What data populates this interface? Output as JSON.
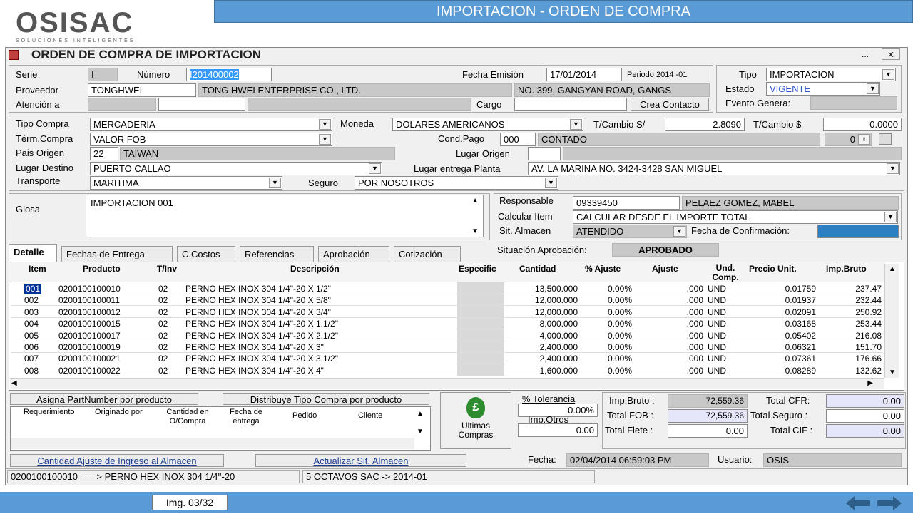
{
  "brand": {
    "logo": "OSISAC",
    "tagline": "SOLUCIONES INTELIGENTES"
  },
  "banner": {
    "title": "IMPORTACION - ORDEN DE COMPRA"
  },
  "window": {
    "title": "ORDEN DE COMPRA DE IMPORTACION",
    "ctrl_more": "...",
    "ctrl_close": "⨯"
  },
  "form": {
    "serie_label": "Serie",
    "serie": "I",
    "numero_label": "Número",
    "numero": "I201400002",
    "fecha_emision_label": "Fecha Emisión",
    "fecha_emision": "17/01/2014",
    "periodo": "Periodo  2014  -01",
    "tipo_label": "Tipo",
    "tipo": "IMPORTACION",
    "estado_label": "Estado",
    "estado": "VIGENTE",
    "evento_label": "Evento Genera:",
    "proveedor_label": "Proveedor",
    "proveedor_code": "TONGHWEI",
    "proveedor_name": "TONG HWEI ENTERPRISE CO., LTD.",
    "proveedor_addr": "NO. 399, GANGYAN ROAD, GANGS",
    "atencion_label": "Atención a",
    "cargo_label": "Cargo",
    "crea_contacto": "Crea Contacto",
    "tipo_compra_label": "Tipo Compra",
    "tipo_compra": "MERCADERIA",
    "moneda_label": "Moneda",
    "moneda": "DOLARES AMERICANOS",
    "tc_s_label": "T/Cambio S/",
    "tc_s": "2.8090",
    "tc_d_label": "T/Cambio $",
    "tc_d": "0.0000",
    "term_label": "Térm.Compra",
    "term": "VALOR FOB",
    "cond_label": "Cond.Pago",
    "cond_code": "000",
    "cond_name": "CONTADO",
    "spin_val": "0",
    "pais_label": "Pais Origen",
    "pais_code": "22",
    "pais_name": "TAIWAN",
    "lugar_origen_label": "Lugar Origen",
    "lugar_destino_label": "Lugar Destino",
    "lugar_destino": "PUERTO CALLAO",
    "lugar_planta_label": "Lugar entrega Planta",
    "lugar_planta": "AV. LA MARINA NO. 3424-3428 SAN MIGUEL",
    "transporte_label": "Transporte",
    "transporte": "MARITIMA",
    "seguro_label": "Seguro",
    "seguro": "POR NOSOTROS",
    "glosa_label": "Glosa",
    "glosa": "IMPORTACION 001",
    "responsable_label": "Responsable",
    "responsable_code": "09339450",
    "responsable_name": "PELAEZ GOMEZ, MABEL",
    "calcular_label": "Calcular Item",
    "calcular": "CALCULAR DESDE EL IMPORTE TOTAL",
    "sit_label": "Sit. Almacen",
    "sit": "ATENDIDO",
    "fecha_conf_label": "Fecha de Confirmación:",
    "sit_aprob_label": "Situación Aprobación:",
    "sit_aprob": "APROBADO"
  },
  "tabs": [
    "Detalle",
    "Fechas de Entrega",
    "C.Costos",
    "Referencias",
    "Aprobación",
    "Cotización"
  ],
  "grid": {
    "headers": [
      "Item",
      "Producto",
      "T/Inv",
      "Descripción",
      "Especific",
      "Cantidad",
      "% Ajuste",
      "Ajuste",
      "Und. Comp.",
      "Precio Unit.",
      "Imp.Bruto"
    ],
    "rows": [
      [
        "001",
        "0200100100010",
        "02",
        "PERNO HEX INOX 304 1/4\"-20 X 1/2\"",
        "",
        "13,500.000",
        "0.00%",
        ".000",
        "UND",
        "0.01759",
        "237.47"
      ],
      [
        "002",
        "0200100100011",
        "02",
        "PERNO HEX INOX 304 1/4\"-20 X 5/8\"",
        "",
        "12,000.000",
        "0.00%",
        ".000",
        "UND",
        "0.01937",
        "232.44"
      ],
      [
        "003",
        "0200100100012",
        "02",
        "PERNO HEX INOX 304 1/4\"-20 X  3/4\"",
        "",
        "12,000.000",
        "0.00%",
        ".000",
        "UND",
        "0.02091",
        "250.92"
      ],
      [
        "004",
        "0200100100015",
        "02",
        "PERNO HEX INOX 304 1/4\"-20 X 1.1/2\"",
        "",
        "8,000.000",
        "0.00%",
        ".000",
        "UND",
        "0.03168",
        "253.44"
      ],
      [
        "005",
        "0200100100017",
        "02",
        "PERNO HEX INOX  304 1/4\"-20 X 2.1/2\"",
        "",
        "4,000.000",
        "0.00%",
        ".000",
        "UND",
        "0.05402",
        "216.08"
      ],
      [
        "006",
        "0200100100019",
        "02",
        "PERNO HEX INOX  304 1/4\"-20 X 3\"",
        "",
        "2,400.000",
        "0.00%",
        ".000",
        "UND",
        "0.06321",
        "151.70"
      ],
      [
        "007",
        "0200100100021",
        "02",
        "PERNO HEX INOX 304 1/4\"-20 X 3.1/2\"",
        "",
        "2,400.000",
        "0.00%",
        ".000",
        "UND",
        "0.07361",
        "176.66"
      ],
      [
        "008",
        "0200100100022",
        "02",
        "PERNO HEX INOX 304 1/4\"-20 X 4\"",
        "",
        "1,600.000",
        "0.00%",
        ".000",
        "UND",
        "0.08289",
        "132.62"
      ]
    ]
  },
  "bottom": {
    "asigna_btn": "Asigna PartNumber por producto",
    "distribuye_btn": "Distribuye Tipo Compra por producto",
    "sub_headers": [
      "Requerimiento",
      "Originado por",
      "Cantidad en O/Compra",
      "Fecha de entrega",
      "Pedido",
      "Cliente"
    ],
    "ultimas_label": "Ultimas Compras",
    "tolerancia_label": "% Tolerancia",
    "tolerancia": "0.00%",
    "imp_otros_label": "Imp.Otros",
    "imp_otros": "0.00",
    "imp_bruto_label": "Imp.Bruto :",
    "imp_bruto": "72,559.36",
    "total_fob_label": "Total FOB :",
    "total_fob": "72,559.36",
    "total_flete_label": "Total Flete :",
    "total_flete": "0.00",
    "total_cfr_label": "Total CFR:",
    "total_cfr": "0.00",
    "total_seguro_label": "Total Seguro :",
    "total_seguro": "0.00",
    "total_cif_label": "Total CIF :",
    "total_cif": "0.00",
    "cantidad_ajuste_link": "Cantidad Ajuste de Ingreso al Almacen",
    "actualizar_btn": "Actualizar Sit. Almacen",
    "fecha_label": "Fecha:",
    "fecha": "02/04/2014 06:59:03 PM",
    "usuario_label": "Usuario:",
    "usuario": "OSIS",
    "status_left": "0200100100010  ===>  PERNO HEX INOX 304 1/4''-20",
    "status_right": "5 OCTAVOS SAC -> 2014-01"
  },
  "footer": {
    "img_label": "Img. 03/32"
  }
}
